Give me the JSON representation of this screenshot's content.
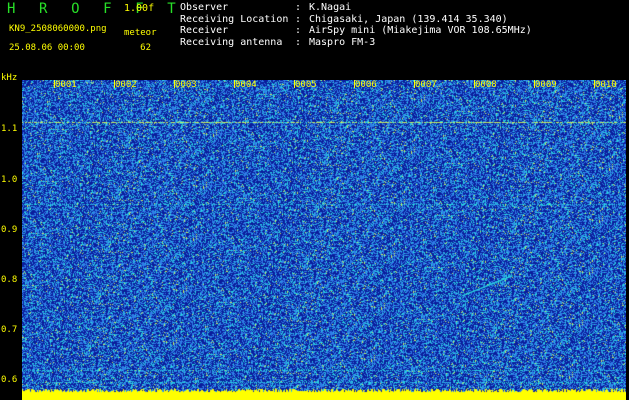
{
  "header": {
    "app_title": "H R O F F T",
    "version": "1.00f",
    "filename": "KN9_2508060000.png",
    "datetime": "25.08.06 00:00",
    "meteor_label": "meteor",
    "meteor_count": "62"
  },
  "station_info": [
    {
      "key": "Observer",
      "sep": ":",
      "value": "K.Nagai"
    },
    {
      "key": "Receiving Location",
      "sep": ":",
      "value": "Chigasaki, Japan (139.414 35.340)"
    },
    {
      "key": "Receiver",
      "sep": ":",
      "value": "AirSpy mini (Miakejima VOR 108.65MHz)"
    },
    {
      "key": "Receiving antenna",
      "sep": ":",
      "value": "Maspro FM-3"
    }
  ],
  "spectrogram": {
    "y_unit": "kHz",
    "y_ticks": [
      "1.1",
      "1.0",
      "0.9",
      "0.8",
      "0.7",
      "0.6"
    ],
    "x_ticks": [
      "0001",
      "0002",
      "0003",
      "0004",
      "0005",
      "0006",
      "0007",
      "0008",
      "0009",
      "0010"
    ],
    "colors": {
      "background": "#0a1d9c",
      "noise_mid": "#2f7fe8",
      "noise_high": "#28d8e0",
      "peak": "#c8f060",
      "label": "#ffff00",
      "baseline": "#ffff00"
    }
  }
}
